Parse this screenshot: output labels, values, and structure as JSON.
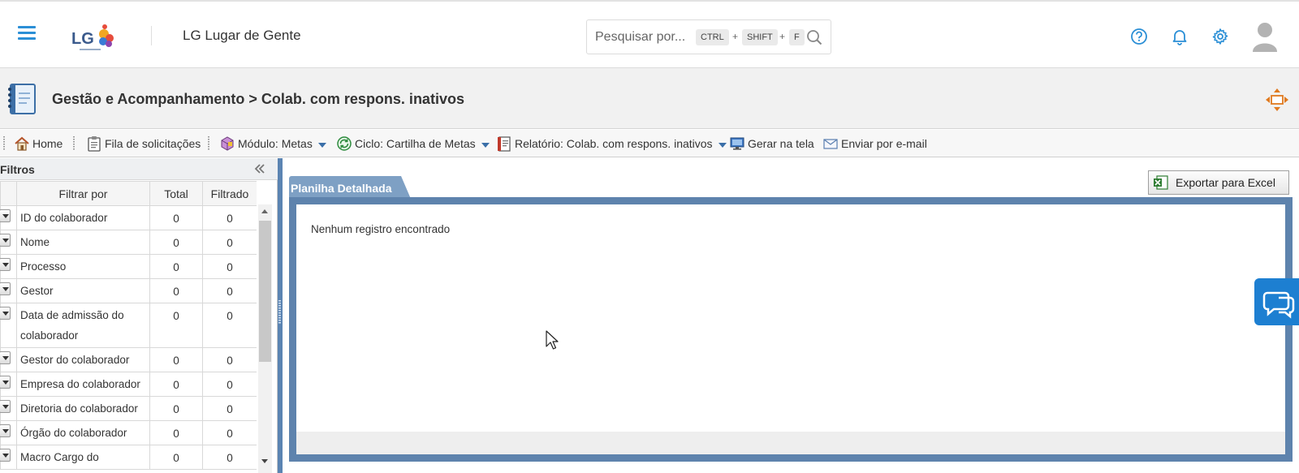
{
  "header": {
    "app_title": "LG Lugar de Gente",
    "logo_text": "LG",
    "search": {
      "placeholder": "Pesquisar por...",
      "keys": [
        "CTRL",
        "SHIFT",
        "F"
      ],
      "plus": "+"
    }
  },
  "page": {
    "title": "Gestão e Acompanhamento > Colab. com respons. inativos"
  },
  "toolbar": {
    "home": "Home",
    "queue": "Fila de solicitações",
    "module": "Módulo: Metas",
    "cycle": "Ciclo: Cartilha de Metas",
    "report": "Relatório: Colab. com respons. inativos",
    "generate": "Gerar na tela",
    "email": "Enviar por e-mail"
  },
  "filters": {
    "title": "Filtros",
    "columns": {
      "filter_by": "Filtrar por",
      "total": "Total",
      "filtered": "Filtrado"
    },
    "rows": [
      {
        "label": "ID do colaborador",
        "total": "0",
        "filtered": "0"
      },
      {
        "label": "Nome",
        "total": "0",
        "filtered": "0"
      },
      {
        "label": "Processo",
        "total": "0",
        "filtered": "0"
      },
      {
        "label": "Gestor",
        "total": "0",
        "filtered": "0"
      },
      {
        "label": "Data de admissão do colaborador",
        "total": "0",
        "filtered": "0"
      },
      {
        "label": "Gestor do colaborador",
        "total": "0",
        "filtered": "0"
      },
      {
        "label": "Empresa do colaborador",
        "total": "0",
        "filtered": "0"
      },
      {
        "label": "Diretoria do colaborador",
        "total": "0",
        "filtered": "0"
      },
      {
        "label": "Órgão do colaborador",
        "total": "0",
        "filtered": "0"
      },
      {
        "label": "Macro Cargo do",
        "total": "0",
        "filtered": "0"
      }
    ]
  },
  "content": {
    "tab_label": "Planilha Detalhada",
    "export_label": "Exportar para Excel",
    "empty_message": "Nenhum registro encontrado"
  },
  "colors": {
    "accent": "#2b8fd6",
    "frame": "#5e83ad",
    "tab": "#7ea0c4",
    "chat": "#1d7fd1"
  }
}
